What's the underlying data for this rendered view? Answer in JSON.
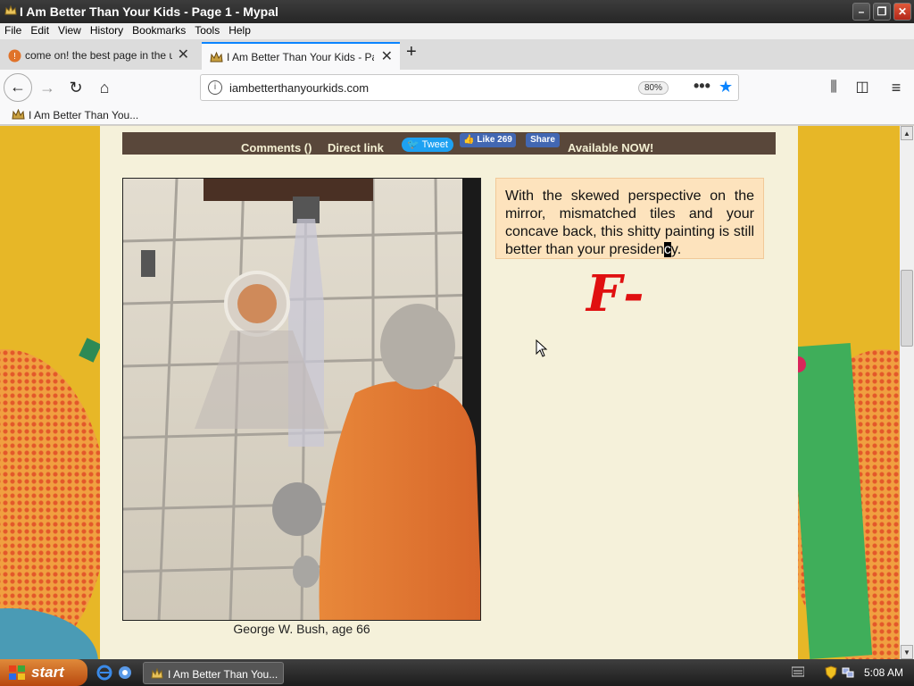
{
  "window": {
    "title": "I Am Better Than Your Kids - Page 1 - Mypal",
    "controls": [
      "minimize",
      "restore",
      "close"
    ]
  },
  "menu": [
    "File",
    "Edit",
    "View",
    "History",
    "Bookmarks",
    "Tools",
    "Help"
  ],
  "tabs": [
    {
      "label": "come on! the best page in the uni",
      "icon": "warning-favicon",
      "active": false
    },
    {
      "label": "I Am Better Than Your Kids - Page",
      "icon": "crown-favicon",
      "active": true
    }
  ],
  "nav": {
    "url": "iambetterthanyourkids.com",
    "zoom": "80%"
  },
  "bookmarks": [
    {
      "label": "I Am Better Than You..."
    }
  ],
  "page": {
    "comments_label": "Comments ()",
    "direct_link_label": "Direct link",
    "tweet_label": "Tweet",
    "like_label": "Like 269",
    "share_label": "Share",
    "available_label": "Available NOW!",
    "caption": "George W. Bush, age 66",
    "review_before": "With the skewed perspective on the mirror, mismatched tiles and your concave back, this shitty painting is still better than your presiden",
    "review_highlight": "c",
    "review_after": "y.",
    "grade": "F-"
  },
  "taskbar": {
    "start_label": "start",
    "app_label": "I Am Better Than You...",
    "clock": "5:08 AM"
  },
  "colors": {
    "page_bg": "#e7b727",
    "content_bg": "#f5f1da",
    "header_bar": "#59473a",
    "review_bg": "#fde3bd",
    "grade_red": "#e01010",
    "accent_blue": "#0a84ff"
  }
}
